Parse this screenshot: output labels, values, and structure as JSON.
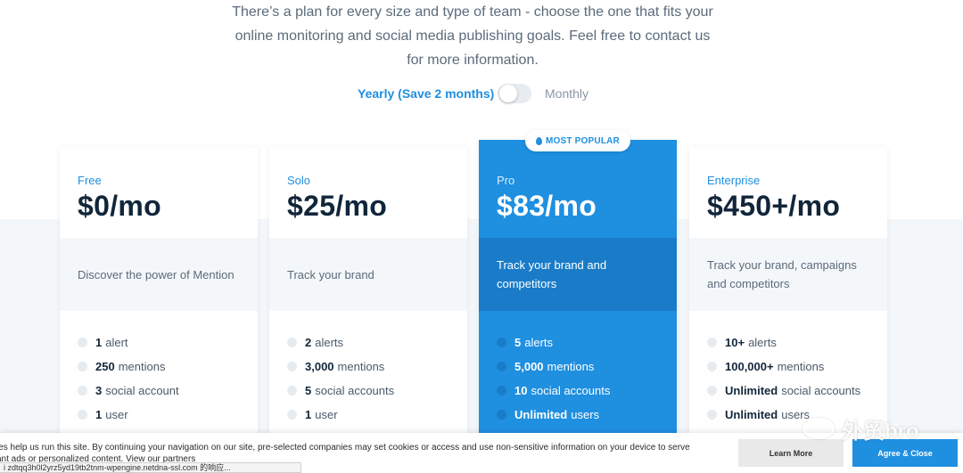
{
  "intro": {
    "line1": "There’s a plan for every size and type of team - choose the one that fits your",
    "line2": "online monitoring and social media publishing goals. Feel free to contact us",
    "line3": "for more information."
  },
  "billing": {
    "yearly_label": "Yearly (Save 2 months)",
    "monthly_label": "Monthly",
    "selected": "Yearly (Save 2 months)"
  },
  "badge": {
    "label": "MOST POPULAR"
  },
  "plans": [
    {
      "name": "Free",
      "price": "$0/mo",
      "description": "Discover the power of Mention",
      "features": [
        {
          "value": "1",
          "label": "alert"
        },
        {
          "value": "250",
          "label": "mentions"
        },
        {
          "value": "3",
          "label": "social account"
        },
        {
          "value": "1",
          "label": "user"
        }
      ]
    },
    {
      "name": "Solo",
      "price": "$25/mo",
      "description": "Track your brand",
      "features": [
        {
          "value": "2",
          "label": "alerts"
        },
        {
          "value": "3,000",
          "label": "mentions"
        },
        {
          "value": "5",
          "label": "social accounts"
        },
        {
          "value": "1",
          "label": "user"
        }
      ]
    },
    {
      "name": "Pro",
      "price": "$83/mo",
      "description": "Track your brand and competitors",
      "features": [
        {
          "value": "5",
          "label": "alerts"
        },
        {
          "value": "5,000",
          "label": "mentions"
        },
        {
          "value": "10",
          "label": "social accounts"
        },
        {
          "value": "Unlimited",
          "label": "users"
        }
      ]
    },
    {
      "name": "Enterprise",
      "price": "$450+/mo",
      "description": "Track your brand, campaigns and competitors",
      "features": [
        {
          "value": "10+",
          "label": "alerts"
        },
        {
          "value": "100,000+",
          "label": "mentions"
        },
        {
          "value": "Unlimited",
          "label": "social accounts"
        },
        {
          "value": "Unlimited",
          "label": "users"
        }
      ]
    }
  ],
  "cookie": {
    "line1": "ies help us run this site. By continuing your navigation on our site, pre-selected companies may set cookies or access and use non-sensitive information on your device to serve",
    "line2": "ant ads or personalized content.",
    "link": "View our partners",
    "learn_more": "Learn More",
    "agree": "Agree & Close"
  },
  "status_bar": {
    "text": "i zdtqq3h0l2yrz5yd19tb2tnm-wpengine.netdna-ssl.com 的响应..."
  },
  "watermark": {
    "text": "外贸bro"
  },
  "colors": {
    "accent": "#1f8fe0",
    "accent_dark": "#1a7cc8",
    "text_dark": "#12263a",
    "muted": "#5b6b7a"
  }
}
